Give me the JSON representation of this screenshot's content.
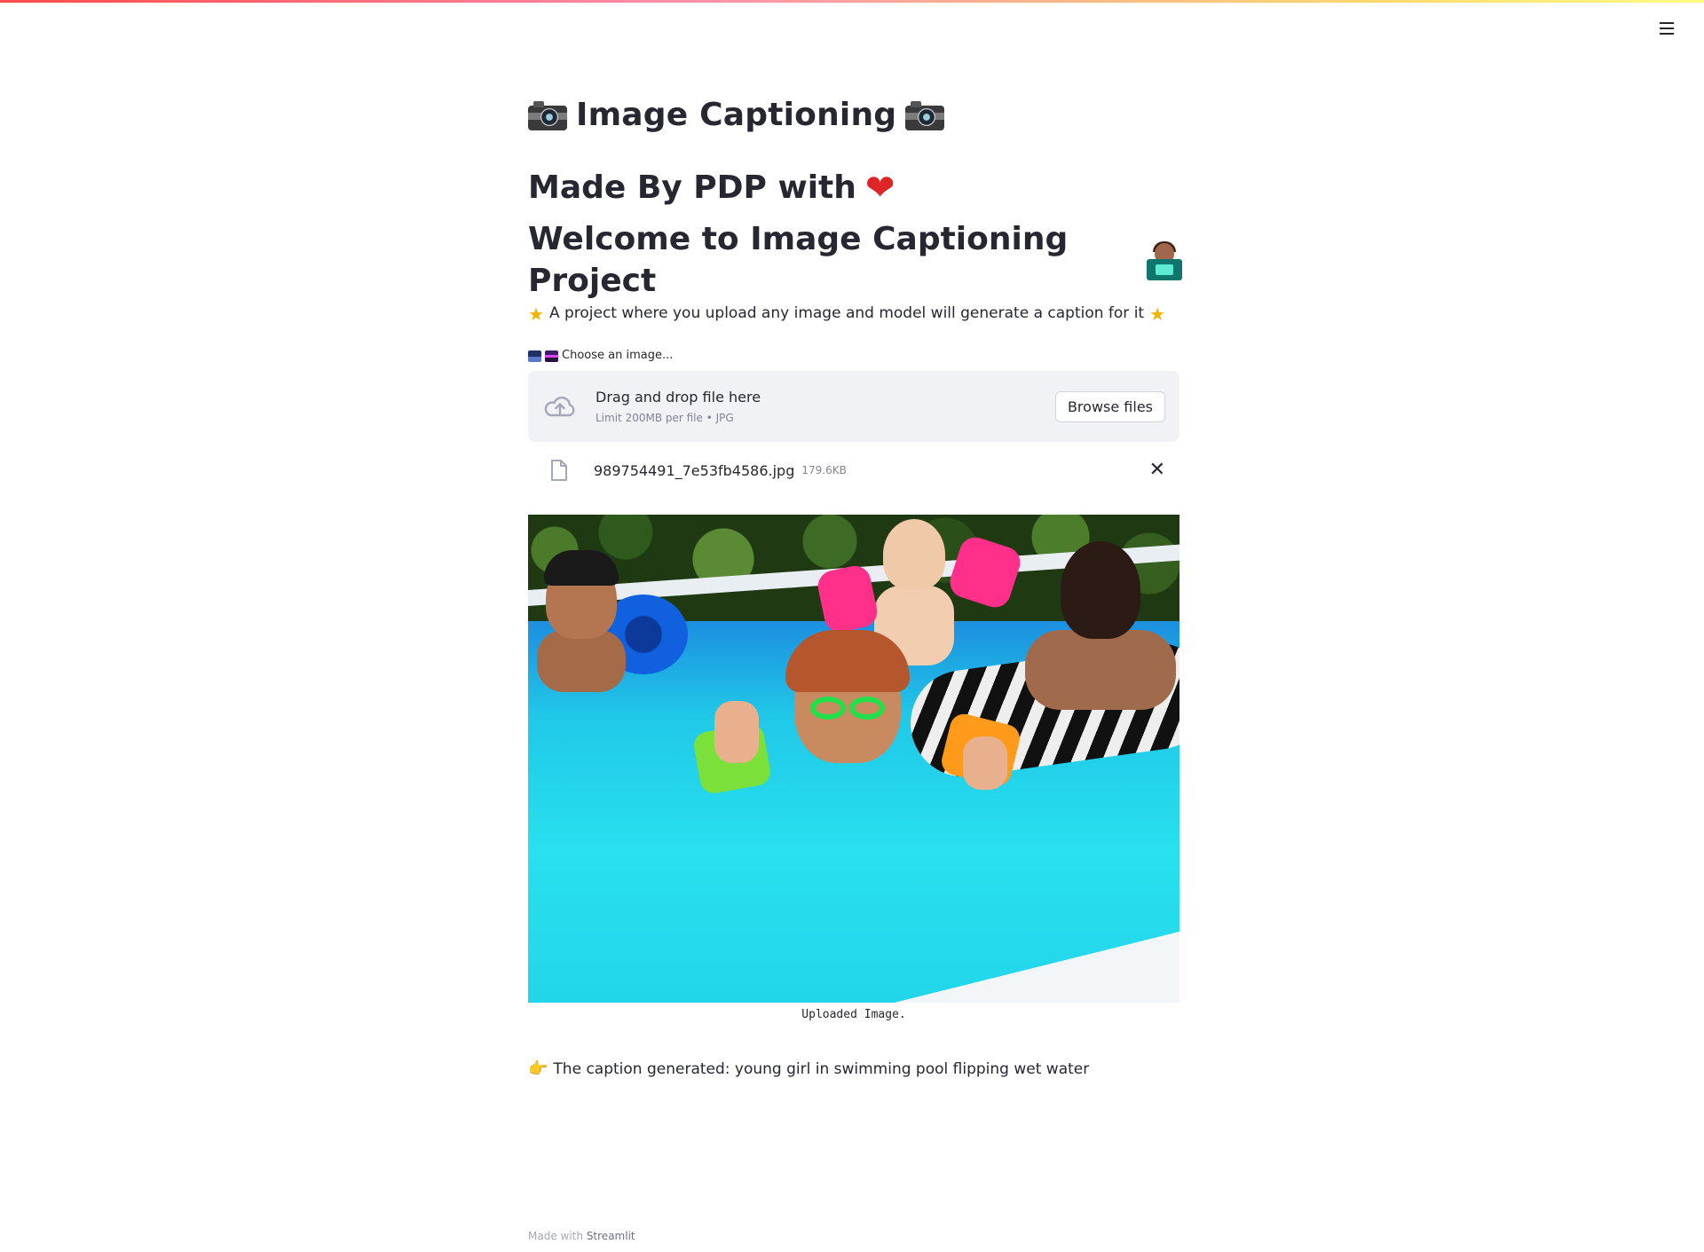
{
  "page": {
    "title": "Image Captioning",
    "subtitle": "Made By PDP with",
    "welcome": "Welcome to Image Captioning Project",
    "description": "A project where you upload any image and model will generate a caption for it"
  },
  "uploader": {
    "label": "Choose an image...",
    "drag_text": "Drag and drop file here",
    "limit_text": "Limit 200MB per file • JPG",
    "browse_label": "Browse files"
  },
  "file": {
    "name": "989754491_7e53fb4586.jpg",
    "size": "179.6KB"
  },
  "image": {
    "caption": "Uploaded Image."
  },
  "result": {
    "text": "The caption generated: young girl in swimming pool flipping wet water"
  },
  "footer": {
    "prefix": "Made with",
    "brand": "Streamlit"
  },
  "icons": {
    "title_left": "camera-icon",
    "title_right": "camera-icon",
    "heart": "heart-icon",
    "technologist": "technologist-icon",
    "star": "star-icon",
    "label_left": "night-city-icon",
    "label_right": "cityscape-dusk-icon",
    "upload": "cloud-upload-icon",
    "file": "file-icon",
    "close": "close-icon",
    "pointer": "pointing-right-icon",
    "menu": "hamburger-menu-icon"
  },
  "colors": {
    "accent_gradient_start": "#ff4b4b",
    "accent_gradient_end": "#fffd80",
    "text": "#262730",
    "dropzone_bg": "#f0f2f6",
    "heart": "#dc2626",
    "star": "#f5b300"
  }
}
